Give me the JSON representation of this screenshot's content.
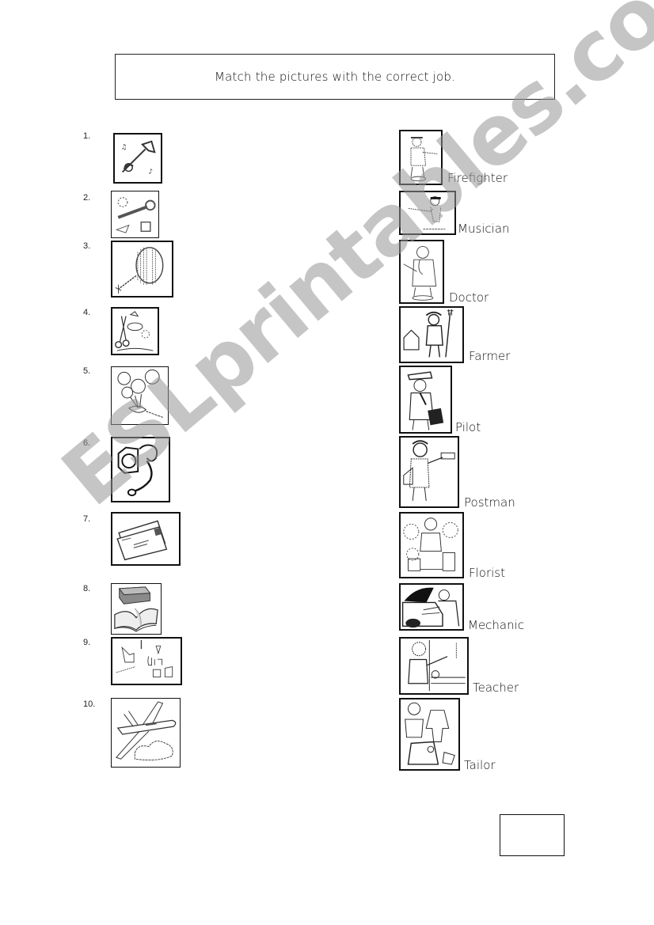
{
  "instructions": "Match the pictures with the correct job.",
  "watermark": "ESLprintables.com",
  "pictures": [
    {
      "number": "1.",
      "icon": "trumpet-icon"
    },
    {
      "number": "2.",
      "icon": "wrench-tools-icon"
    },
    {
      "number": "3.",
      "icon": "fire-hose-reel-icon"
    },
    {
      "number": "4.",
      "icon": "sewing-supplies-icon"
    },
    {
      "number": "5.",
      "icon": "flower-bouquet-icon"
    },
    {
      "number": "6.",
      "icon": "stethoscope-icon"
    },
    {
      "number": "7.",
      "icon": "letters-envelopes-icon"
    },
    {
      "number": "8.",
      "icon": "books-icon"
    },
    {
      "number": "9.",
      "icon": "farm-tools-icon"
    },
    {
      "number": "10.",
      "icon": "airplane-icon"
    }
  ],
  "jobs": [
    {
      "label": "Firefighter",
      "icon": "firefighter-icon"
    },
    {
      "label": "Musician",
      "icon": "musician-icon"
    },
    {
      "label": "Doctor",
      "icon": "doctor-icon"
    },
    {
      "label": "Farmer",
      "icon": "farmer-icon"
    },
    {
      "label": "Pilot",
      "icon": "pilot-icon"
    },
    {
      "label": "Postman",
      "icon": "postman-icon"
    },
    {
      "label": "Florist",
      "icon": "florist-icon"
    },
    {
      "label": "Mechanic",
      "icon": "mechanic-icon"
    },
    {
      "label": "Teacher",
      "icon": "teacher-icon"
    },
    {
      "label": "Tailor",
      "icon": "tailor-icon"
    }
  ]
}
